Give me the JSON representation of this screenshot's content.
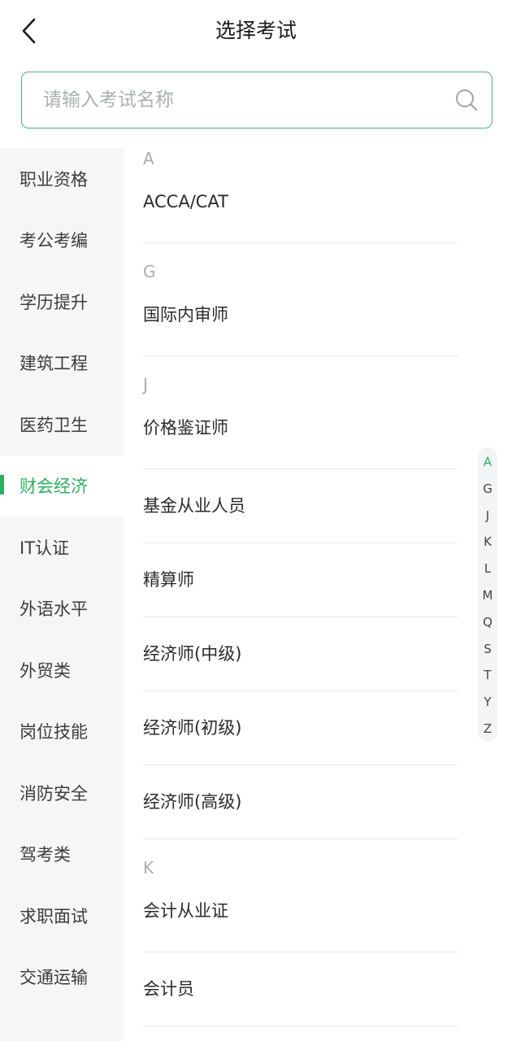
{
  "header": {
    "title": "选择考试"
  },
  "search": {
    "placeholder": "请输入考试名称"
  },
  "sidebar": {
    "items": [
      {
        "label": "职业资格"
      },
      {
        "label": "考公考编"
      },
      {
        "label": "学历提升"
      },
      {
        "label": "建筑工程"
      },
      {
        "label": "医药卫生"
      },
      {
        "label": "财会经济",
        "active": true
      },
      {
        "label": "IT认证"
      },
      {
        "label": "外语水平"
      },
      {
        "label": "外贸类"
      },
      {
        "label": "岗位技能"
      },
      {
        "label": "消防安全"
      },
      {
        "label": "驾考类"
      },
      {
        "label": "求职面试"
      },
      {
        "label": "交通运输"
      }
    ]
  },
  "groups": [
    {
      "letter": "A",
      "exams": [
        "ACCA/CAT"
      ]
    },
    {
      "letter": "G",
      "exams": [
        "国际内审师"
      ]
    },
    {
      "letter": "J",
      "exams": [
        "价格鉴证师",
        "基金从业人员",
        "精算师",
        "经济师(中级)",
        "经济师(初级)",
        "经济师(高级)"
      ]
    },
    {
      "letter": "K",
      "exams": [
        "会计从业证",
        "会计员"
      ]
    }
  ],
  "index_bar": {
    "letters": [
      "A",
      "G",
      "J",
      "K",
      "L",
      "M",
      "Q",
      "S",
      "T",
      "Y",
      "Z"
    ],
    "active": "A"
  },
  "colors": {
    "accent": "#2bb05f",
    "search_border": "#4cb374",
    "sidebar_bg": "#f5f6f8"
  }
}
